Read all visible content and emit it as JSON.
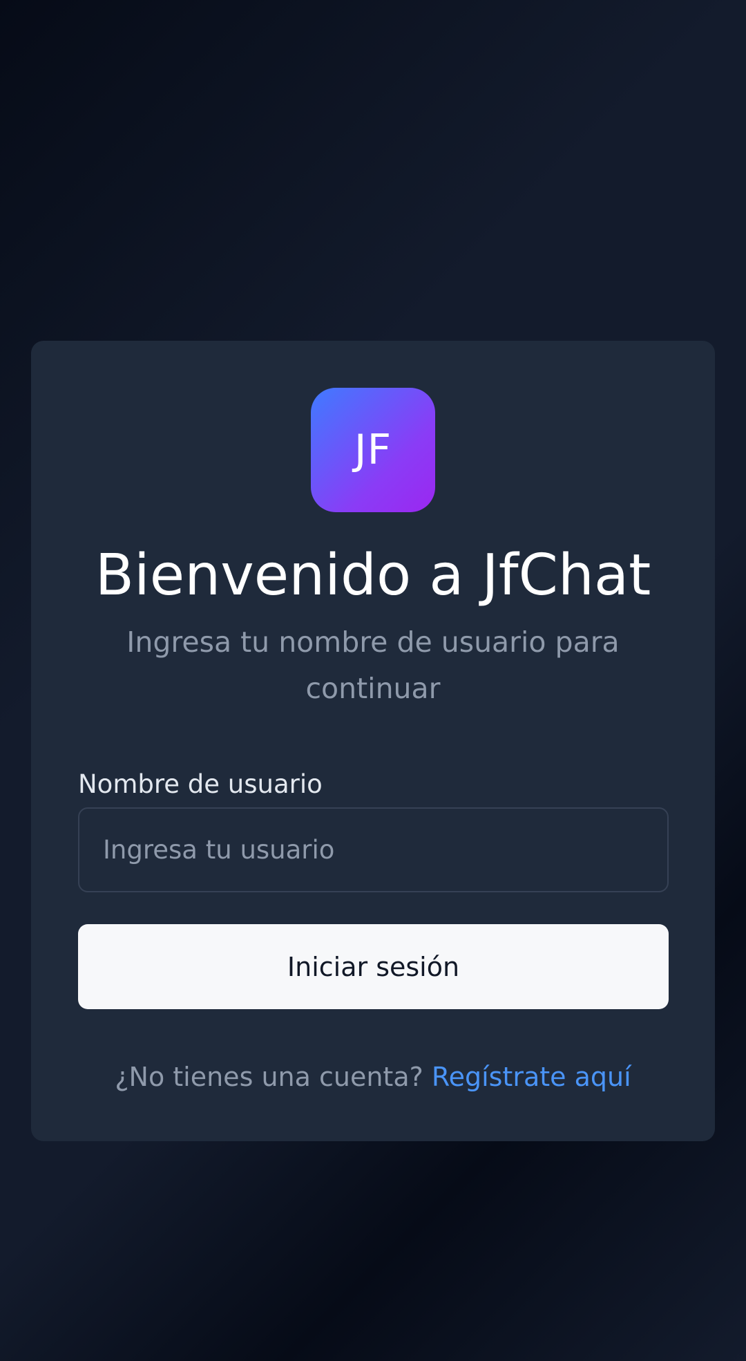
{
  "logo": {
    "initials": "JF"
  },
  "header": {
    "title": "Bienvenido a JfChat",
    "subtitle": "Ingresa tu nombre de usuario para continuar"
  },
  "form": {
    "username_label": "Nombre de usuario",
    "username_placeholder": "Ingresa tu usuario",
    "username_value": "",
    "submit_label": "Iniciar sesión"
  },
  "footer": {
    "prompt": "¿No tienes una cuenta?",
    "register_link": "Regístrate aquí"
  },
  "colors": {
    "card_background": "#1f2a3b",
    "accent_link": "#4a94f7",
    "logo_gradient_start": "#3f7bff",
    "logo_gradient_end": "#9b27f0",
    "button_background": "#f7f8fa"
  }
}
